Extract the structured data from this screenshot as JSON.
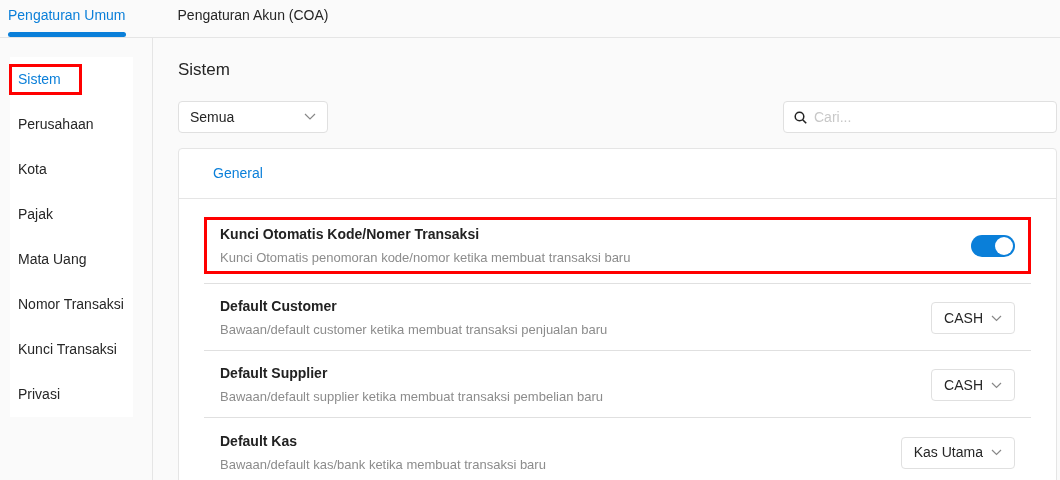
{
  "tabs": [
    {
      "label": "Pengaturan Umum",
      "selected": true
    },
    {
      "label": "Pengaturan Akun (COA)",
      "selected": false
    }
  ],
  "sidebar": {
    "items": [
      {
        "label": "Sistem",
        "selected": true,
        "highlighted": true
      },
      {
        "label": "Perusahaan",
        "selected": false,
        "highlighted": false
      },
      {
        "label": "Kota",
        "selected": false,
        "highlighted": false
      },
      {
        "label": "Pajak",
        "selected": false,
        "highlighted": false
      },
      {
        "label": "Mata Uang",
        "selected": false,
        "highlighted": false
      },
      {
        "label": "Nomor Transaksi",
        "selected": false,
        "highlighted": false
      },
      {
        "label": "Kunci Transaksi",
        "selected": false,
        "highlighted": false
      },
      {
        "label": "Privasi",
        "selected": false,
        "highlighted": false
      }
    ]
  },
  "content": {
    "title": "Sistem",
    "filter": {
      "value": "Semua"
    },
    "search": {
      "placeholder": "Cari..."
    },
    "section": {
      "title": "General",
      "settings": [
        {
          "kind": "toggle",
          "title": "Kunci Otomatis Kode/Nomer Transaksi",
          "description": "Kunci Otomatis penomoran kode/nomor ketika membuat transaksi baru",
          "on": true,
          "highlighted": true
        },
        {
          "kind": "select",
          "title": "Default Customer",
          "description": "Bawaan/default customer ketika membuat transaksi penjualan baru",
          "value": "CASH",
          "highlighted": false
        },
        {
          "kind": "select",
          "title": "Default Supplier",
          "description": "Bawaan/default supplier ketika membuat transaksi pembelian baru",
          "value": "CASH",
          "highlighted": false
        },
        {
          "kind": "select",
          "title": "Default Kas",
          "description": "Bawaan/default kas/bank ketika membuat transaksi baru",
          "value": "Kas Utama",
          "highlighted": false
        }
      ]
    }
  }
}
